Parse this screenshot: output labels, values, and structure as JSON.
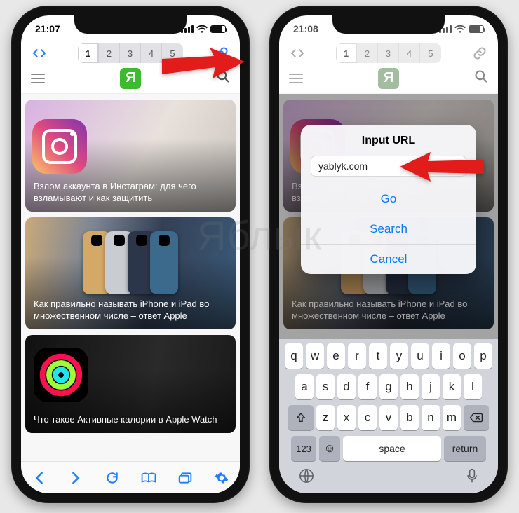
{
  "watermark": "Яблык",
  "phone_left": {
    "time": "21:07",
    "tabs": [
      "1",
      "2",
      "3",
      "4",
      "5"
    ],
    "selected_tab": 0,
    "logo": "Я",
    "cards": [
      "Взлом аккаунта в Инстаграм: для чего взламывают и как защитить",
      "Как правильно называть iPhone и iPad во множественном числе – ответ Apple",
      "Что такое Активные калории в Apple Watch"
    ]
  },
  "phone_right": {
    "time": "21:08",
    "tabs": [
      "1",
      "2",
      "3",
      "4",
      "5"
    ],
    "selected_tab": 0,
    "logo": "Я",
    "cards": [
      "Взлом аккаунта в Инстаграм: для чего взламывают и как защитить",
      "Как правильно называть iPhone и iPad во множественном числе – ответ Apple"
    ],
    "modal": {
      "title": "Input URL",
      "input_value": "yablyk.com",
      "go": "Go",
      "search": "Search",
      "cancel": "Cancel"
    },
    "keyboard": {
      "row1": [
        "q",
        "w",
        "e",
        "r",
        "t",
        "y",
        "u",
        "i",
        "o",
        "p"
      ],
      "row2": [
        "a",
        "s",
        "d",
        "f",
        "g",
        "h",
        "j",
        "k",
        "l"
      ],
      "row3": [
        "z",
        "x",
        "c",
        "v",
        "b",
        "n",
        "m"
      ],
      "num": "123",
      "space": "space",
      "return": "return"
    }
  }
}
